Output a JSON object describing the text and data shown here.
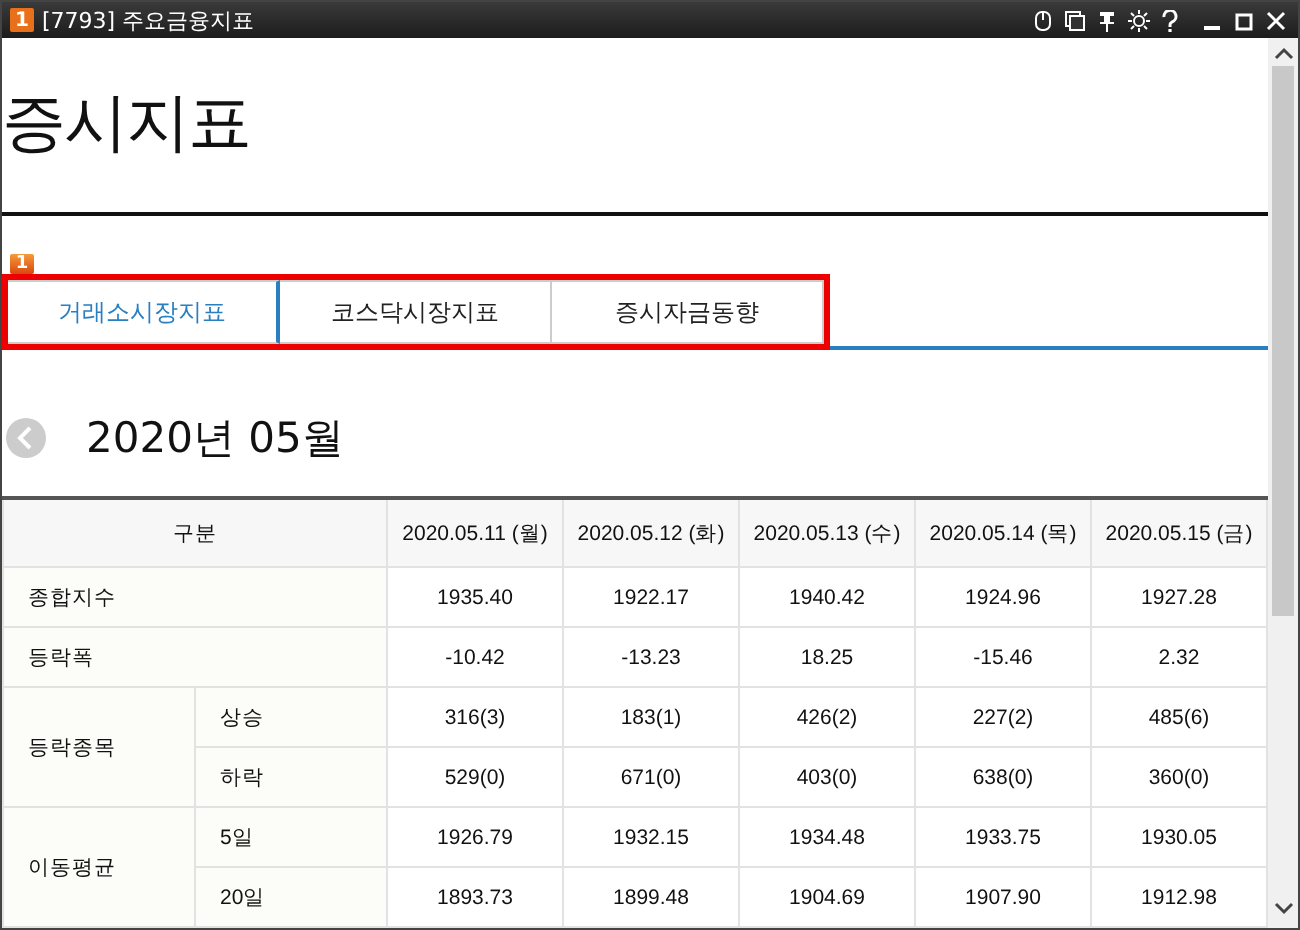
{
  "window": {
    "badge": "1",
    "title": "[7793] 주요금융지표"
  },
  "heading": "증시지표",
  "tab_badge": "1",
  "tabs": [
    {
      "label": "거래소시장지표",
      "selected": true
    },
    {
      "label": "코스닥시장지표",
      "selected": false
    },
    {
      "label": "증시자금동향",
      "selected": false
    }
  ],
  "month": "2020년 05월",
  "table": {
    "corner": "구분",
    "columns": [
      "2020.05.11 (월)",
      "2020.05.12 (화)",
      "2020.05.13 (수)",
      "2020.05.14 (목)",
      "2020.05.15 (금)"
    ],
    "groups": [
      {
        "label": "종합지수",
        "rows": [
          {
            "values": [
              "1935.40",
              "1922.17",
              "1940.42",
              "1924.96",
              "1927.28"
            ]
          }
        ]
      },
      {
        "label": "등락폭",
        "rows": [
          {
            "values": [
              "-10.42",
              "-13.23",
              "18.25",
              "-15.46",
              "2.32"
            ]
          }
        ]
      },
      {
        "label": "등락종목",
        "rows": [
          {
            "sublabel": "상승",
            "values": [
              "316(3)",
              "183(1)",
              "426(2)",
              "227(2)",
              "485(6)"
            ]
          },
          {
            "sublabel": "하락",
            "values": [
              "529(0)",
              "671(0)",
              "403(0)",
              "638(0)",
              "360(0)"
            ]
          }
        ]
      },
      {
        "label": "이동평균",
        "rows": [
          {
            "sublabel": "5일",
            "values": [
              "1926.79",
              "1932.15",
              "1934.48",
              "1933.75",
              "1930.05"
            ]
          },
          {
            "sublabel": "20일",
            "values": [
              "1893.73",
              "1899.48",
              "1904.69",
              "1907.90",
              "1912.98"
            ]
          }
        ]
      }
    ]
  }
}
